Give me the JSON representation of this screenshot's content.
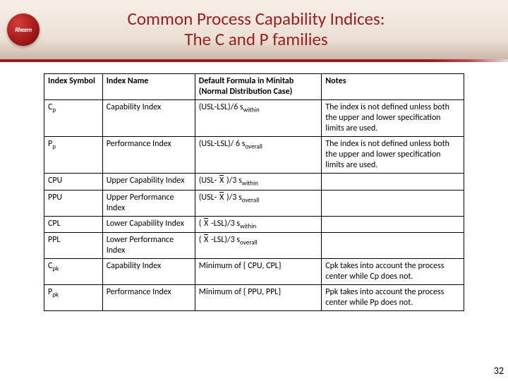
{
  "header": {
    "logo_text": "Rheem",
    "title_line1": "Common Process Capability Indices:",
    "title_line2": "The C and P families"
  },
  "table": {
    "headers": {
      "symbol": "Index Symbol",
      "name": "Index Name",
      "formula": "Default Formula in Minitab (Normal Distribution Case)",
      "notes": "Notes"
    },
    "rows": {
      "cp": {
        "sym_base": "C",
        "sym_sub": "p",
        "name": "Capability Index",
        "f_pre": "(USL-LSL)/6 s",
        "f_sub": "within",
        "notes": "The index is not defined unless both the upper and lower specification limits are used."
      },
      "pp": {
        "sym_base": "P",
        "sym_sub": "p",
        "name": "Performance Index",
        "f_pre": "(USL-LSL)/ 6 s",
        "f_sub": "overall",
        "notes": "The index is not defined unless both the upper and lower specification limits are used."
      },
      "cpu": {
        "sym": "CPU",
        "name": "Upper Capability Index",
        "f_a": "(USL- ",
        "f_b": " )/3 s",
        "f_sub": "within",
        "notes": ""
      },
      "ppu": {
        "sym": "PPU",
        "name": "Upper Performance Index",
        "f_a": "(USL- ",
        "f_b": " )/3 s",
        "f_sub": "overall",
        "notes": ""
      },
      "cpl": {
        "sym": "CPL",
        "name": "Lower Capability Index",
        "f_a": "( ",
        "f_b": " -LSL)/3 s",
        "f_sub": "within",
        "notes": ""
      },
      "ppl": {
        "sym": "PPL",
        "name": "Lower Performance Index",
        "f_a": "( ",
        "f_b": " -LSL)/3 s",
        "f_sub": "overall",
        "notes": ""
      },
      "cpk": {
        "sym_base": "C",
        "sym_sub": "pk",
        "name": "Capability Index",
        "formula": "Minimum of { CPU, CPL}",
        "notes": "Cpk takes into account the process center while Cp does not."
      },
      "ppk": {
        "sym_base": "P",
        "sym_sub": "pk",
        "name": "Performance Index",
        "formula": "Minimum of { PPU, PPL}",
        "notes": "Ppk takes into account the process center while Pp does not."
      }
    }
  },
  "xbar_glyph": "X",
  "page_number": "32"
}
